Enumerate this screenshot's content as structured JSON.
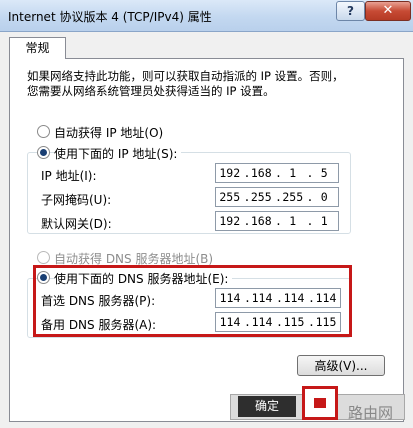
{
  "window": {
    "title": "Internet 协议版本 4 (TCP/IPv4) 属性",
    "help_label": "?",
    "close_label": "✕"
  },
  "tabs": [
    {
      "label": "常规"
    }
  ],
  "general": {
    "intro_line1": "如果网络支持此功能，则可以获取自动指派的 IP 设置。否则，",
    "intro_line2": "您需要从网络系统管理员处获得适当的 IP 设置。",
    "ip_auto_label": "自动获得 IP 地址(O)",
    "ip_manual_label": "使用下面的 IP 地址(S):",
    "ip_address": {
      "label": "IP 地址(I):",
      "octets": [
        "192",
        "168",
        "1",
        "5"
      ]
    },
    "subnet_mask": {
      "label": "子网掩码(U):",
      "octets": [
        "255",
        "255",
        "255",
        "0"
      ]
    },
    "gateway": {
      "label": "默认网关(D):",
      "octets": [
        "192",
        "168",
        "1",
        "1"
      ]
    },
    "dns_auto_label": "自动获得 DNS 服务器地址(B)",
    "dns_manual_label": "使用下面的 DNS 服务器地址(E):",
    "dns_preferred": {
      "label": "首选 DNS 服务器(P):",
      "octets": [
        "114",
        "114",
        "114",
        "114"
      ]
    },
    "dns_alternate": {
      "label": "备用 DNS 服务器(A):",
      "octets": [
        "114",
        "114",
        "115",
        "115"
      ]
    },
    "advanced_label": "高级(V)...",
    "ok_label": "确定"
  },
  "watermark": {
    "text": "路由网"
  }
}
